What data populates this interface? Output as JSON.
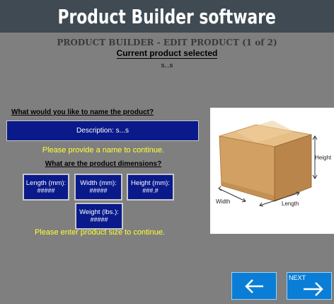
{
  "header": {
    "title": "Product Builder software"
  },
  "page": {
    "heading": "PRODUCT BUILDER - EDIT PRODUCT (1 of 2)",
    "subheading": "Current product selected",
    "current_product": "s...s"
  },
  "name_section": {
    "question": "What would you like to name the product?",
    "description_button": "Description: s...s",
    "warning": "Please provide a name to continue."
  },
  "dimensions_section": {
    "question": "What are the product dimensions?",
    "length": {
      "label": "Length (mm):",
      "value": "#####"
    },
    "width": {
      "label": "Width (mm):",
      "value": "#####"
    },
    "height": {
      "label": "Height (mm):",
      "value": "###.#"
    },
    "weight": {
      "label": "Weight (lbs.):",
      "value": "#####"
    },
    "warning": "Please enter product size to continue."
  },
  "illustration": {
    "width_label": "Width",
    "length_label": "Length",
    "height_label": "Height"
  },
  "navigation": {
    "back_icon": "left-arrow-icon",
    "next_label": "NEXT",
    "next_icon": "right-arrow-icon"
  },
  "colors": {
    "background": "#7f7f7f",
    "title_bar": "#3f4a52",
    "button_blue": "#0a1a8a",
    "nav_blue": "#0a7ed6",
    "warning_yellow": "#ffff33"
  }
}
